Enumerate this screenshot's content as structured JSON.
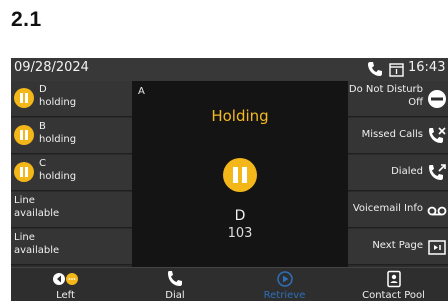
{
  "section_heading": "2.1",
  "topbar": {
    "date": "09/28/2024",
    "time": "16:43"
  },
  "left_keys": [
    {
      "line1": "D",
      "line2": "holding",
      "icon": "hold-icon"
    },
    {
      "line1": "B",
      "line2": "holding",
      "icon": "hold-icon"
    },
    {
      "line1": "C",
      "line2": "holding",
      "icon": "hold-icon"
    },
    {
      "line1": "Line",
      "line2": "available"
    },
    {
      "line1": "Line",
      "line2": "available"
    }
  ],
  "call": {
    "id": "A",
    "status": "Holding",
    "name": "D",
    "number": "103"
  },
  "right_keys": {
    "dnd": {
      "line1": "Do Not Disturb",
      "line2": "Off",
      "icon": "dnd-icon"
    },
    "missed": {
      "label": "Missed Calls",
      "icon": "missed-call-icon"
    },
    "dialed": {
      "label": "Dialed",
      "icon": "dialed-call-icon"
    },
    "voicemail": {
      "label": "Voicemail Info",
      "icon": "voicemail-icon"
    },
    "next": {
      "label": "Next Page",
      "icon": "next-page-icon"
    }
  },
  "softkeys": {
    "left": "Left",
    "dial": "Dial",
    "retrieve": "Retrieve",
    "contact": "Contact Pool"
  },
  "colors": {
    "hold_yellow": "#f3b71a",
    "status_yellow": "#f5b922",
    "retrieve_blue": "#2d6fb8"
  }
}
